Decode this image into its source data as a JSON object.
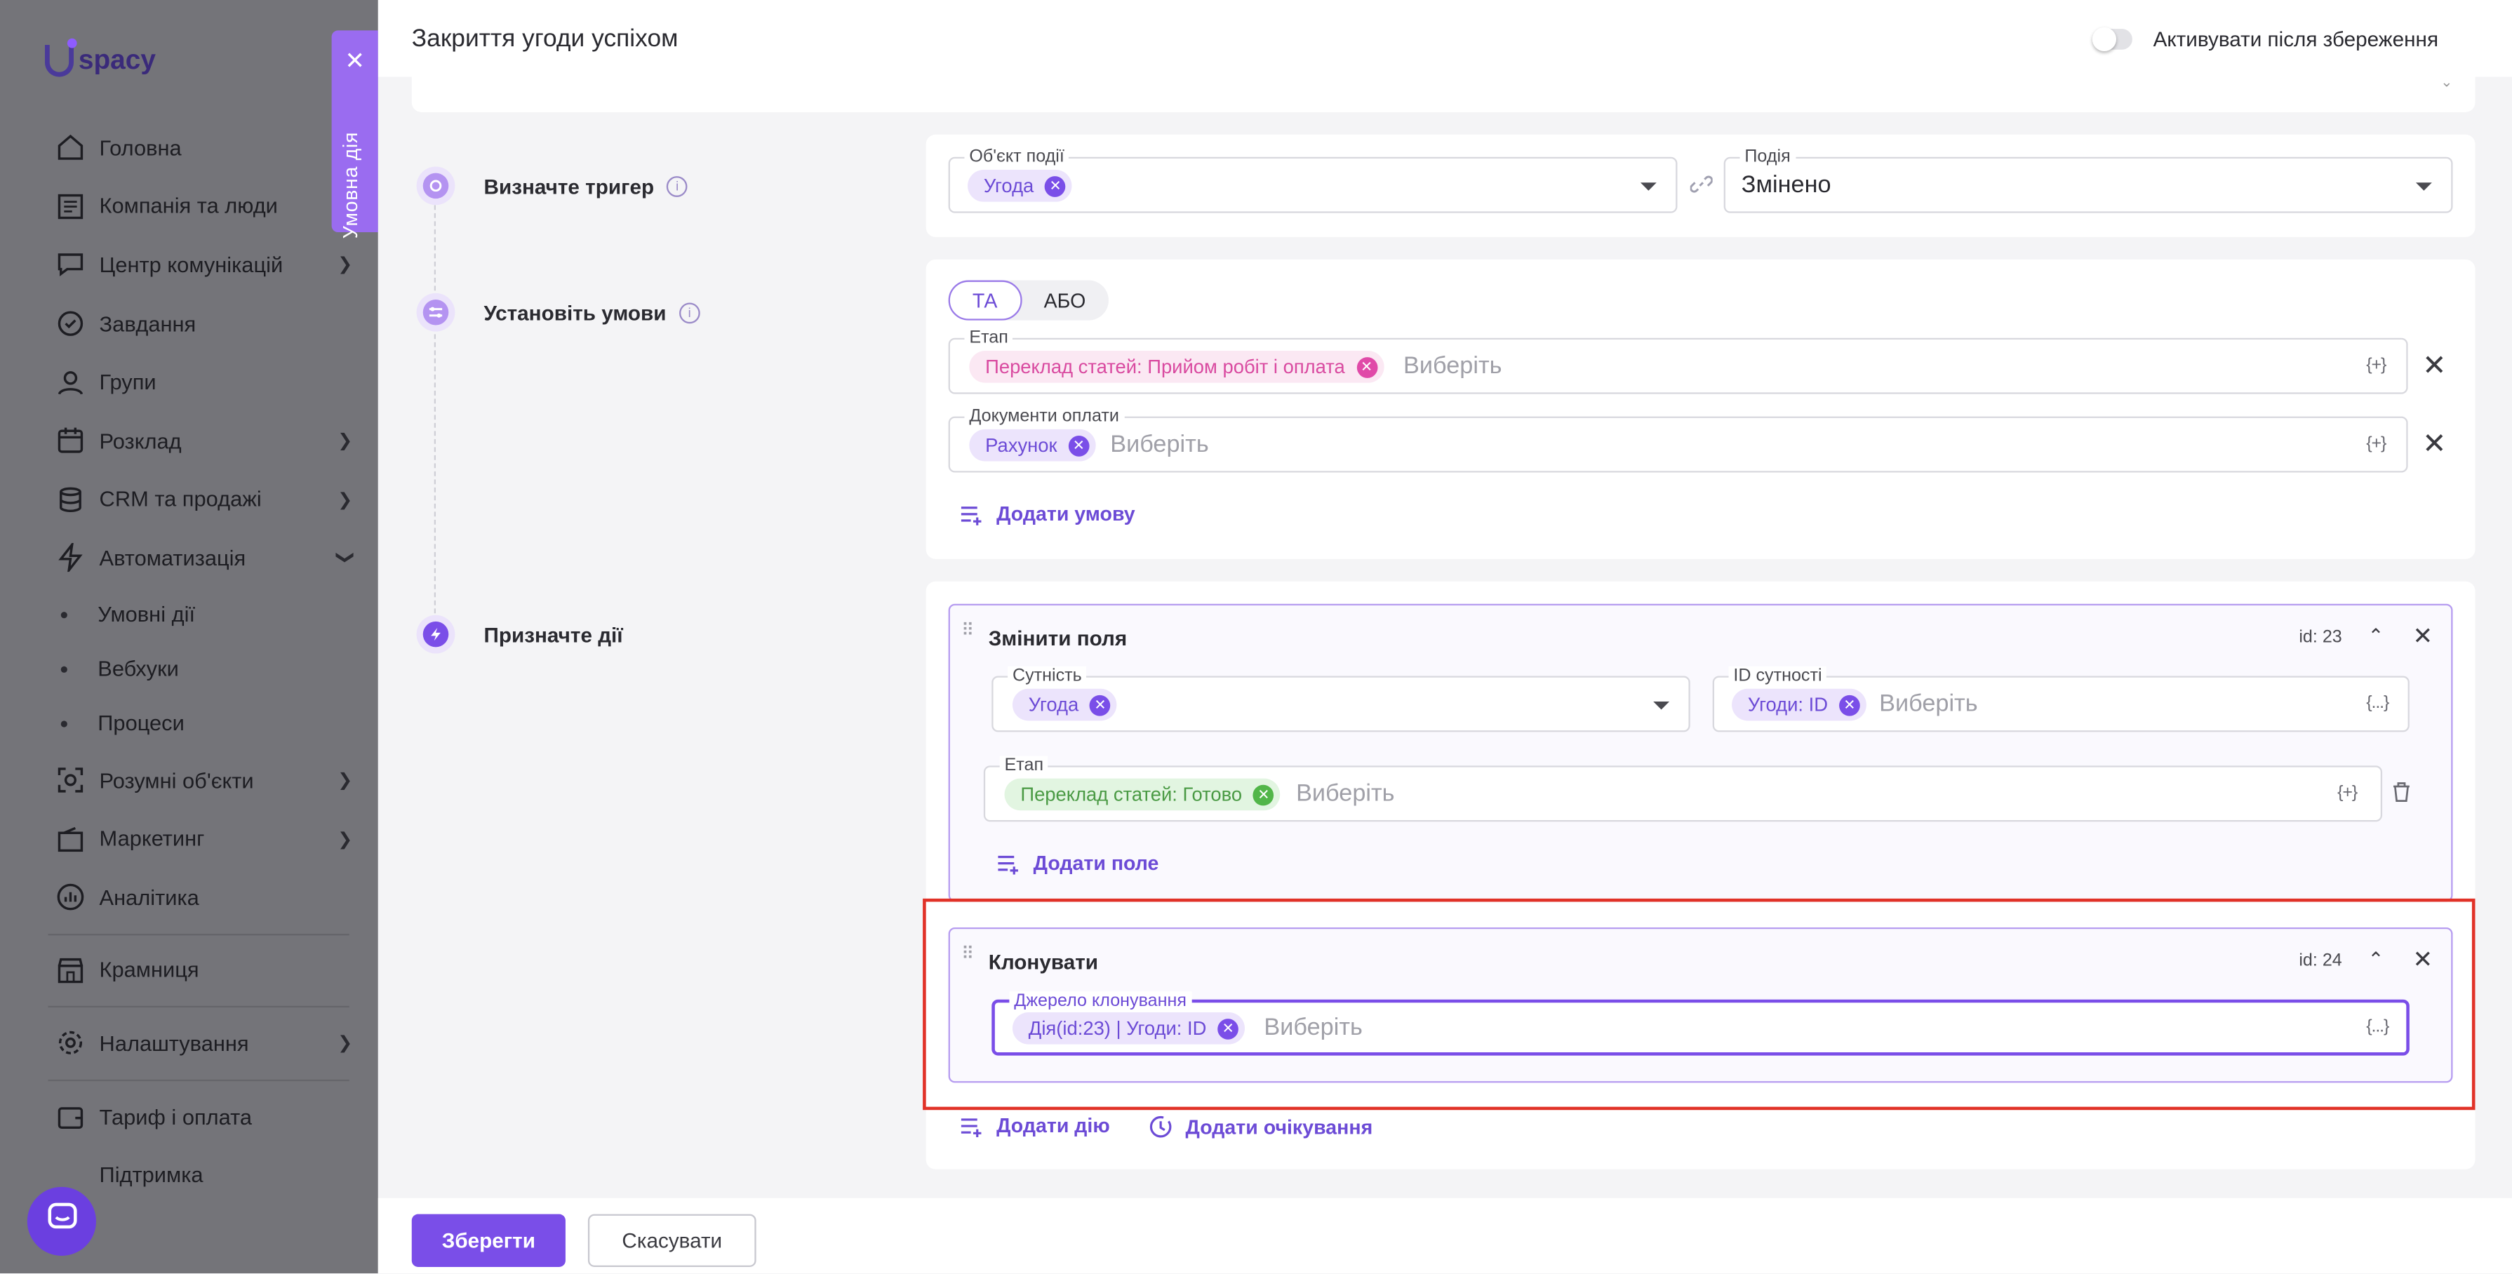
{
  "sidebar": {
    "logo": "spacy",
    "items": [
      {
        "label": "Головна",
        "icon": "home-icon"
      },
      {
        "label": "Компанія та люди",
        "icon": "company-icon"
      },
      {
        "label": "Центр комунікацій",
        "icon": "chat-icon",
        "chevron": true
      },
      {
        "label": "Завдання",
        "icon": "check-circle-icon"
      },
      {
        "label": "Групи",
        "icon": "people-icon"
      },
      {
        "label": "Розклад",
        "icon": "calendar-icon",
        "chevron": true
      },
      {
        "label": "CRM та продажі",
        "icon": "database-icon",
        "chevron": true
      },
      {
        "label": "Автоматизація",
        "icon": "lightning-icon",
        "expanded": true
      }
    ],
    "sub_items": [
      "Умовні дії",
      "Вебхуки",
      "Процеси"
    ],
    "items2": [
      {
        "label": "Розумні об'єкти",
        "icon": "smart-objects-icon"
      },
      {
        "label": "Маркетинг",
        "icon": "marketing-icon"
      },
      {
        "label": "Аналітика",
        "icon": "analytics-icon"
      }
    ],
    "shop": "Крамниця",
    "settings": "Налаштування",
    "tariff": "Тариф і оплата",
    "support": "Підтримка"
  },
  "panel_tab": "Умовна дія",
  "header": {
    "title": "Закриття угоди успіхом",
    "toggle_label": "Активувати після збереження"
  },
  "steps": {
    "trigger": "Визначте тригер",
    "conditions": "Установіть умови",
    "actions": "Призначте дії"
  },
  "trigger": {
    "object_label": "Об'єкт події",
    "object_chip": "Угода",
    "event_label": "Подія",
    "event_value": "Змінено"
  },
  "conditions": {
    "and": "ТА",
    "or": "АБО",
    "rows": [
      {
        "label": "Етап",
        "chip": "Переклад статей: Прийом робіт і оплата",
        "placeholder": "Виберіть",
        "var": "{+}"
      },
      {
        "label": "Документи оплати",
        "chip": "Рахунок",
        "placeholder": "Виберіть",
        "var": "{+}"
      }
    ],
    "add_condition": "Додати умову"
  },
  "actions": {
    "change_fields": {
      "title": "Змінити поля",
      "id": "id: 23",
      "entity_label": "Сутність",
      "entity_chip": "Угода",
      "entity_id_label": "ID сутності",
      "entity_id_chip": "Угоди: ID",
      "entity_id_placeholder": "Виберіть",
      "stage_label": "Етап",
      "stage_chip": "Переклад статей: Готово",
      "stage_placeholder": "Виберіть",
      "var": "{+}",
      "var2": "{...}",
      "add_field": "Додати поле"
    },
    "clone": {
      "title": "Клонувати",
      "id": "id: 24",
      "source_label": "Джерело клонування",
      "source_chip": "Дія(id:23) | Угоди: ID",
      "source_placeholder": "Виберіть",
      "var": "{...}"
    },
    "add_action": "Додати дію",
    "add_wait": "Додати очікування"
  },
  "footer": {
    "save": "Зберегти",
    "cancel": "Скасувати"
  },
  "colors": {
    "accent": "#7a4ee8",
    "highlight": "#e13228"
  }
}
